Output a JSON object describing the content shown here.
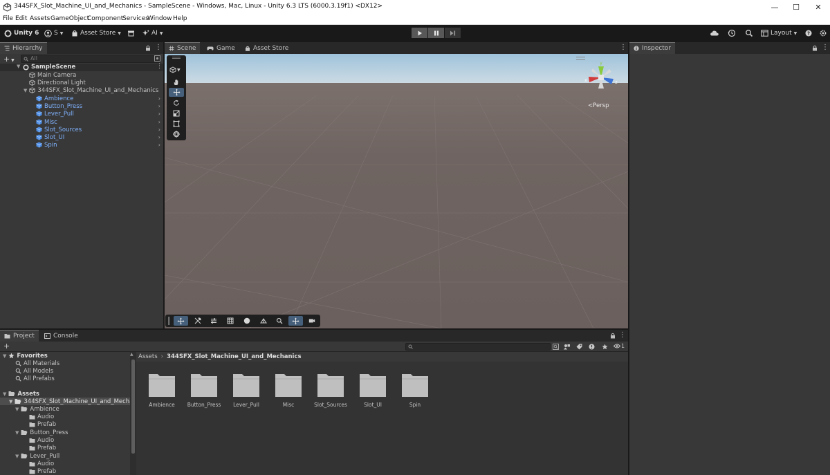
{
  "window": {
    "title": "344SFX_Slot_Machine_UI_and_Mechanics - SampleScene - Windows, Mac, Linux - Unity 6.3 LTS (6000.3.19f1) <DX12>",
    "minimize": "—",
    "maximize": "☐",
    "close": "✕"
  },
  "menu": [
    "File",
    "Edit",
    "Assets",
    "GameObject",
    "Component",
    "Services",
    "Window",
    "Help"
  ],
  "toolbar": {
    "unity_label": "Unity 6",
    "account_label": "S",
    "asset_store_label": "Asset Store",
    "ai_label": "AI",
    "layout_label": "Layout"
  },
  "hierarchy": {
    "tab": "Hierarchy",
    "search_placeholder": "All",
    "scene": "SampleScene",
    "items": [
      "Main Camera",
      "Directional Light",
      "344SFX_Slot_Machine_UI_and_Mechanics"
    ],
    "prefabs": [
      "Ambience",
      "Button_Press",
      "Lever_Pull",
      "Misc",
      "Slot_Sources",
      "Slot_UI",
      "Spin"
    ]
  },
  "scene_view": {
    "tabs": [
      "Scene",
      "Game",
      "Asset Store"
    ],
    "projection": "Persp",
    "gizmo_axes": {
      "x": "x",
      "y": "y",
      "z": "z"
    }
  },
  "inspector": {
    "tab": "Inspector"
  },
  "project": {
    "tabs": [
      "Project",
      "Console"
    ],
    "favorites": {
      "label": "Favorites",
      "items": [
        "All Materials",
        "All Models",
        "All Prefabs"
      ]
    },
    "assets": {
      "label": "Assets",
      "root": "344SFX_Slot_Machine_UI_and_Mechanics",
      "tree": [
        {
          "name": "Ambience",
          "children": [
            "Audio",
            "Prefab"
          ]
        },
        {
          "name": "Button_Press",
          "children": [
            "Audio",
            "Prefab"
          ]
        },
        {
          "name": "Lever_Pull",
          "children": [
            "Audio",
            "Prefab"
          ]
        }
      ]
    },
    "breadcrumb": {
      "root": "Assets",
      "current": "344SFX_Slot_Machine_UI_and_Mechanics"
    },
    "folders": [
      "Ambience",
      "Button_Press",
      "Lever_Pull",
      "Misc",
      "Slot_Sources",
      "Slot_UI",
      "Spin"
    ],
    "hidden_count": "1"
  },
  "colors": {
    "accent": "#46607c",
    "prefab_text": "#80b3ff",
    "panel": "#383838",
    "sky": "#b9d3e4",
    "ground": "#6e6360"
  }
}
